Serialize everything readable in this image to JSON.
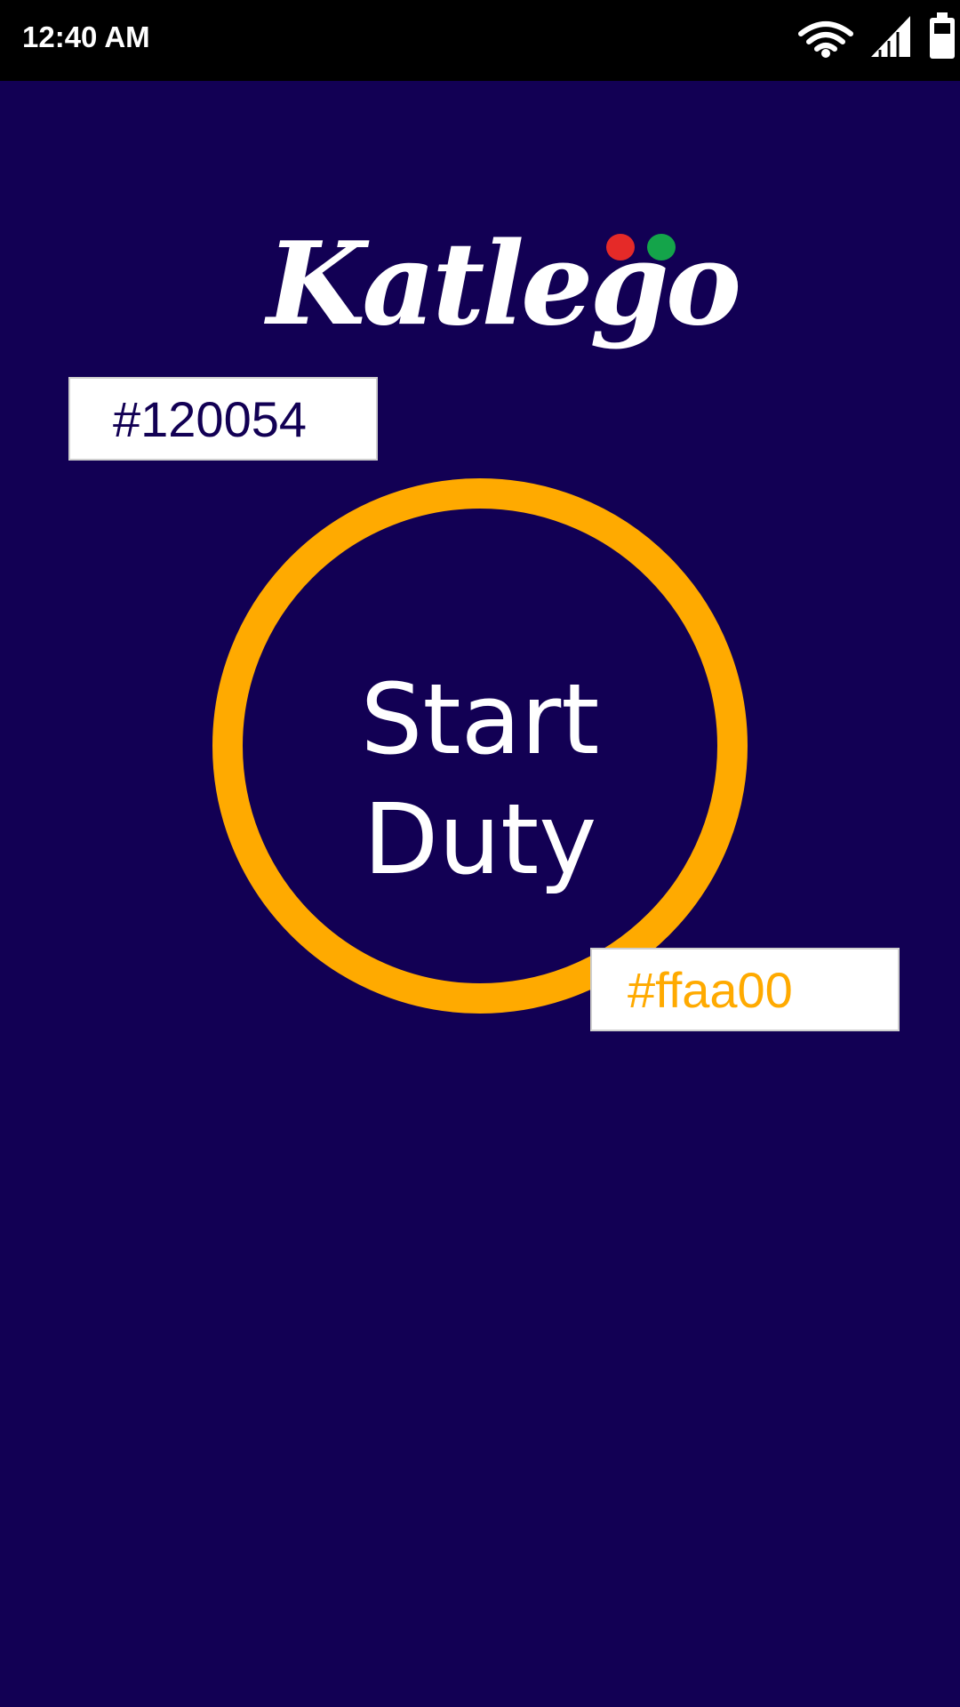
{
  "status_bar": {
    "time": "12:40 AM",
    "icons": [
      "wifi-icon",
      "signal-icon",
      "battery-icon"
    ]
  },
  "logo": {
    "text": "Katlego",
    "dot_colors": [
      "#e52a28",
      "#14a44a"
    ]
  },
  "swatches": {
    "background": "#120054",
    "accent": "#ffaa00"
  },
  "start_duty": {
    "label_line1": "Start",
    "label_line2": "Duty"
  },
  "colors": {
    "background": "#120054",
    "accent": "#ffaa00",
    "status_bar": "#000000",
    "text": "#ffffff"
  }
}
